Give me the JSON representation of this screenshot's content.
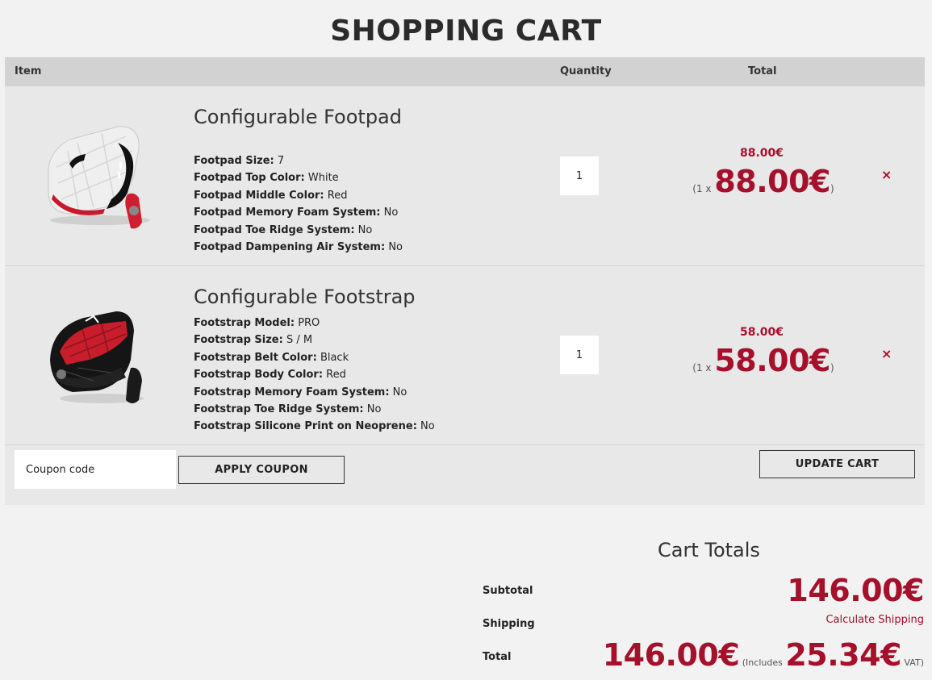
{
  "page": {
    "title": "SHOPPING CART"
  },
  "table": {
    "headers": {
      "item": "Item",
      "quantity": "Quantity",
      "total": "Total"
    }
  },
  "items": [
    {
      "name": "Configurable Footpad",
      "image_icon": "footpad-product-image",
      "options": [
        {
          "label": "Footpad Size:",
          "value": "7"
        },
        {
          "label": "Footpad Top Color:",
          "value": "White"
        },
        {
          "label": "Footpad Middle Color:",
          "value": "Red"
        },
        {
          "label": "Footpad Memory Foam System:",
          "value": "No"
        },
        {
          "label": "Footpad Toe Ridge System:",
          "value": "No"
        },
        {
          "label": "Footpad Dampening Air System:",
          "value": "No"
        }
      ],
      "quantity": "1",
      "line_total": "88.00€",
      "unit_prefix": "(1 x",
      "unit_price": "88.00€",
      "unit_suffix": ")",
      "remove": "×"
    },
    {
      "name": "Configurable Footstrap",
      "image_icon": "footstrap-product-image",
      "options": [
        {
          "label": "Footstrap Model:",
          "value": "PRO"
        },
        {
          "label": "Footstrap Size:",
          "value": "S / M"
        },
        {
          "label": "Footstrap Belt Color:",
          "value": "Black"
        },
        {
          "label": "Footstrap Body Color:",
          "value": "Red"
        },
        {
          "label": "Footstrap Memory Foam System:",
          "value": "No"
        },
        {
          "label": "Footstrap Toe Ridge System:",
          "value": "No"
        },
        {
          "label": "Footstrap Silicone Print on Neoprene:",
          "value": "No"
        }
      ],
      "quantity": "1",
      "line_total": "58.00€",
      "unit_prefix": "(1 x",
      "unit_price": "58.00€",
      "unit_suffix": ")",
      "remove": "×"
    }
  ],
  "coupon": {
    "placeholder": "Coupon code",
    "apply_label": "APPLY COUPON"
  },
  "update_label": "UPDATE CART",
  "totals": {
    "title": "Cart Totals",
    "subtotal_label": "Subtotal",
    "subtotal_value": "146.00€",
    "shipping_label": "Shipping",
    "shipping_link": "Calculate Shipping",
    "total_label": "Total",
    "total_value": "146.00€",
    "includes_prefix": "(Includes",
    "vat_value": "25.34€",
    "vat_suffix": "VAT)"
  },
  "colors": {
    "accent": "#a5102b",
    "header_bg": "#d2d2d2",
    "panel_bg": "#e8e8e8",
    "page_bg": "#f2f2f2"
  }
}
